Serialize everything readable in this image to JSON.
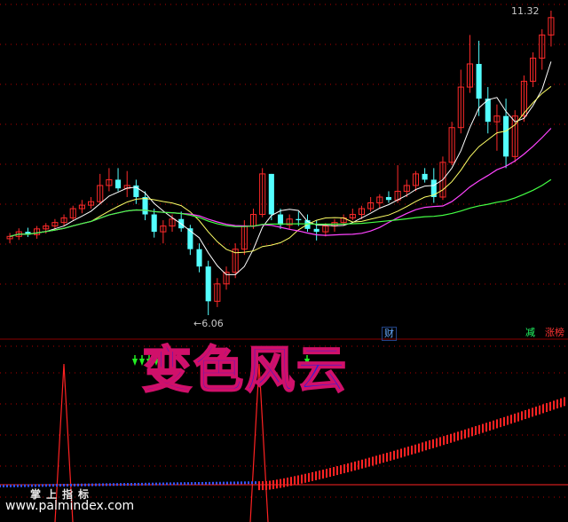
{
  "price_labels": {
    "high": "11.32",
    "low": "6.06"
  },
  "badges": {
    "fin": "财",
    "reduce": "减",
    "limit_board": "涨榜"
  },
  "title_overlay": "变色风云",
  "footer": {
    "title": "掌上指标",
    "url": "www.palmindex.com"
  },
  "colors": {
    "up": "#ff2a2a",
    "down": "#54ffff",
    "ma5": "#ffffff",
    "ma10": "#ffff66",
    "ma20": "#ff44ff",
    "ma60": "#44ff44",
    "grid": "#b00000"
  },
  "chart_data": {
    "type": "candlestick",
    "candles": [
      [
        7.38,
        7.48,
        7.3,
        7.42
      ],
      [
        7.42,
        7.56,
        7.36,
        7.5
      ],
      [
        7.5,
        7.57,
        7.41,
        7.45
      ],
      [
        7.45,
        7.6,
        7.38,
        7.55
      ],
      [
        7.55,
        7.65,
        7.47,
        7.6
      ],
      [
        7.6,
        7.72,
        7.54,
        7.66
      ],
      [
        7.66,
        7.8,
        7.6,
        7.74
      ],
      [
        7.74,
        7.95,
        7.7,
        7.9
      ],
      [
        7.9,
        8.05,
        7.82,
        7.96
      ],
      [
        7.96,
        8.1,
        7.9,
        8.02
      ],
      [
        8.02,
        8.5,
        7.98,
        8.3
      ],
      [
        8.3,
        8.6,
        8.2,
        8.4
      ],
      [
        8.4,
        8.6,
        8.2,
        8.25
      ],
      [
        8.25,
        8.55,
        8.1,
        8.3
      ],
      [
        8.3,
        8.4,
        7.98,
        8.1
      ],
      [
        8.1,
        8.2,
        7.7,
        7.8
      ],
      [
        7.8,
        7.9,
        7.4,
        7.5
      ],
      [
        7.5,
        7.7,
        7.3,
        7.6
      ],
      [
        7.6,
        7.8,
        7.5,
        7.72
      ],
      [
        7.72,
        7.85,
        7.5,
        7.56
      ],
      [
        7.56,
        7.62,
        7.1,
        7.2
      ],
      [
        7.2,
        7.3,
        6.8,
        6.9
      ],
      [
        6.9,
        7.0,
        6.06,
        6.3
      ],
      [
        6.3,
        6.7,
        6.2,
        6.6
      ],
      [
        6.6,
        6.9,
        6.5,
        6.8
      ],
      [
        6.8,
        7.3,
        6.7,
        7.2
      ],
      [
        7.2,
        7.7,
        7.1,
        7.6
      ],
      [
        7.6,
        7.9,
        7.55,
        7.8
      ],
      [
        7.8,
        8.6,
        7.75,
        8.5
      ],
      [
        8.5,
        8.5,
        7.7,
        7.8
      ],
      [
        7.8,
        7.9,
        7.55,
        7.62
      ],
      [
        7.62,
        7.8,
        7.55,
        7.72
      ],
      [
        7.72,
        7.85,
        7.6,
        7.7
      ],
      [
        7.7,
        7.8,
        7.5,
        7.55
      ],
      [
        7.55,
        7.7,
        7.35,
        7.5
      ],
      [
        7.5,
        7.65,
        7.42,
        7.6
      ],
      [
        7.6,
        7.72,
        7.5,
        7.66
      ],
      [
        7.66,
        7.8,
        7.6,
        7.74
      ],
      [
        7.74,
        7.9,
        7.7,
        7.8
      ],
      [
        7.8,
        7.95,
        7.72,
        7.9
      ],
      [
        7.9,
        8.1,
        7.85,
        8.0
      ],
      [
        8.0,
        8.15,
        7.9,
        8.1
      ],
      [
        8.1,
        8.2,
        8.0,
        8.05
      ],
      [
        8.05,
        8.65,
        8.0,
        8.2
      ],
      [
        8.2,
        8.4,
        8.1,
        8.3
      ],
      [
        8.3,
        8.55,
        8.2,
        8.5
      ],
      [
        8.5,
        8.6,
        8.35,
        8.4
      ],
      [
        8.4,
        8.6,
        8.0,
        8.1
      ],
      [
        8.1,
        8.8,
        8.05,
        8.7
      ],
      [
        8.7,
        9.4,
        8.65,
        9.3
      ],
      [
        9.3,
        10.3,
        9.2,
        10.0
      ],
      [
        10.0,
        10.9,
        9.9,
        10.4
      ],
      [
        10.4,
        10.8,
        9.5,
        9.8
      ],
      [
        9.8,
        10.0,
        9.2,
        9.4
      ],
      [
        9.4,
        9.7,
        8.9,
        9.5
      ],
      [
        9.5,
        9.8,
        8.6,
        8.8
      ],
      [
        8.8,
        9.6,
        8.7,
        9.5
      ],
      [
        9.5,
        10.2,
        9.4,
        10.1
      ],
      [
        10.1,
        10.6,
        10.0,
        10.5
      ],
      [
        10.5,
        11.0,
        10.3,
        10.9
      ],
      [
        10.9,
        11.32,
        10.7,
        11.2
      ]
    ]
  }
}
